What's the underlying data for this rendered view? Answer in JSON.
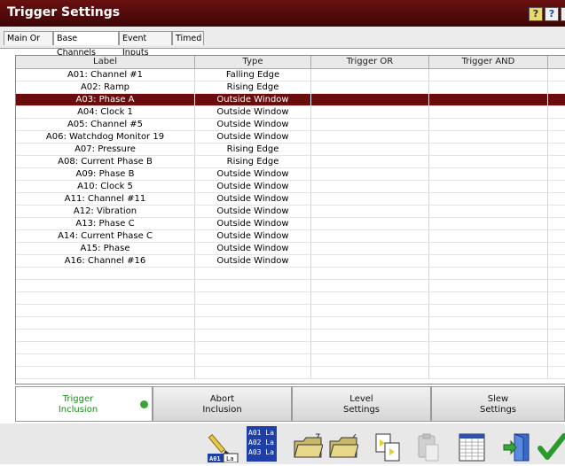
{
  "window": {
    "title": "Trigger Settings",
    "help_icon": "?"
  },
  "tabs": [
    {
      "label": "Main Or"
    },
    {
      "label": "Base Channels"
    },
    {
      "label": "Event Inputs"
    },
    {
      "label": "Timed"
    }
  ],
  "grid": {
    "columns": [
      "Label",
      "Type",
      "Trigger OR",
      "Trigger AND"
    ],
    "selected_row": 2,
    "rows": [
      {
        "label": "A01: Channel #1",
        "type": "Falling Edge"
      },
      {
        "label": "A02: Ramp",
        "type": "Rising Edge"
      },
      {
        "label": "A03: Phase A",
        "type": "Outside Window"
      },
      {
        "label": "A04: Clock 1",
        "type": "Outside Window"
      },
      {
        "label": "A05: Channel #5",
        "type": "Outside Window"
      },
      {
        "label": "A06: Watchdog Monitor 19",
        "type": "Outside Window"
      },
      {
        "label": "A07: Pressure",
        "type": "Rising Edge"
      },
      {
        "label": "A08: Current Phase B",
        "type": "Rising Edge"
      },
      {
        "label": "A09: Phase B",
        "type": "Outside Window"
      },
      {
        "label": "A10: Clock 5",
        "type": "Outside Window"
      },
      {
        "label": "A11: Channel #11",
        "type": "Outside Window"
      },
      {
        "label": "A12: Vibration",
        "type": "Outside Window"
      },
      {
        "label": "A13: Phase C",
        "type": "Outside Window"
      },
      {
        "label": "A14: Current Phase C",
        "type": "Outside Window"
      },
      {
        "label": "A15: Phase",
        "type": "Outside Window"
      },
      {
        "label": "A16: Channel #16",
        "type": "Outside Window"
      }
    ]
  },
  "bottom_tabs": [
    {
      "line1": "Trigger",
      "line2": "Inclusion"
    },
    {
      "line1": "Abort",
      "line2": "Inclusion"
    },
    {
      "line1": "Level",
      "line2": "Settings"
    },
    {
      "line1": "Slew",
      "line2": "Settings"
    }
  ],
  "toolbar": {
    "label_icon_text": "A01 La",
    "list_icon_lines": [
      "A01 La",
      "A02 La",
      "A03 La"
    ],
    "icons": [
      "pencil-label-icon",
      "channel-list-icon",
      "open-folder-icon",
      "save-folder-icon",
      "copy-icon",
      "paste-icon",
      "spreadsheet-icon",
      "exit-door-icon",
      "checkmark-icon"
    ]
  },
  "colors": {
    "accent": "#6b0d0d",
    "status_led": "#3aa63a"
  }
}
